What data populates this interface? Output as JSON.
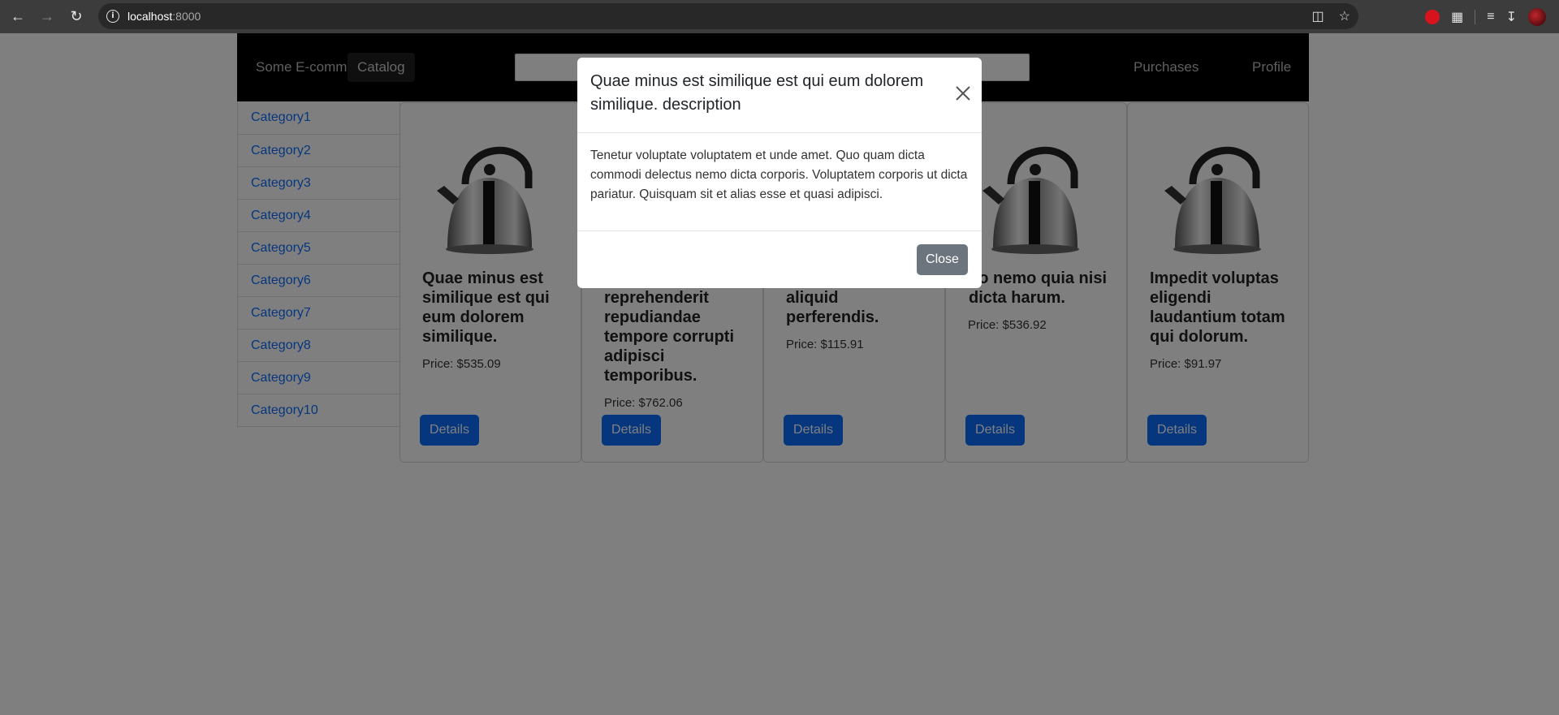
{
  "browser": {
    "url_host": "localhost",
    "url_port": ":8000"
  },
  "navbar": {
    "brand": "Some E-comm",
    "catalog": "Catalog",
    "search_placeholder": "",
    "purchases": "Purchases",
    "profile": "Profile"
  },
  "sidebar": {
    "categories": [
      "Category1",
      "Category2",
      "Category3",
      "Category4",
      "Category5",
      "Category6",
      "Category7",
      "Category8",
      "Category9",
      "Category10"
    ]
  },
  "products": [
    {
      "title": "Quae minus est similique est qui eum dolorem similique.",
      "price": "Price: $535.09"
    },
    {
      "title": "reprehenderit repudiandae tempore corrupti adipisci temporibus.",
      "price": "Price: $762.06"
    },
    {
      "title": "aliquid perferendis.",
      "price": "Price: $115.91"
    },
    {
      "title": "uo nemo quia nisi dicta harum.",
      "price": "Price: $536.92"
    },
    {
      "title": "Impedit voluptas eligendi laudantium totam qui dolorum.",
      "price": "Price: $91.97"
    }
  ],
  "details_label": "Details",
  "modal": {
    "title": "Quae minus est similique est qui eum dolorem similique. description",
    "body": "Tenetur voluptate voluptatem et unde amet. Quo quam dicta commodi delectus nemo dicta corporis. Voluptatem corporis ut dicta pariatur. Quisquam sit et alias esse et quasi adipisci.",
    "close_label": "Close"
  },
  "colors": {
    "link": "#0d6efd",
    "primary_button": "#0d6efd",
    "secondary_button": "#6c757d",
    "navbar": "#000000"
  }
}
